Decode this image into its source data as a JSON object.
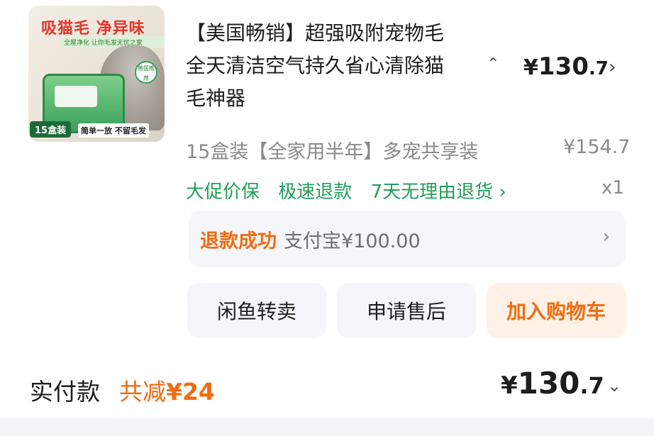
{
  "product": {
    "image": {
      "banner": "吸猫毛 净异味",
      "tagline": "全屋净化 让你毛发无忧之家",
      "badge": "15盒装",
      "slogan": "简单一放 不留毛发",
      "recommend": "兽医推荐"
    },
    "title": "【美国畅销】超强吸附宠物毛全天清洁空气持久省心清除猫毛神器",
    "price_symbol": "¥",
    "price_int": "130",
    "price_dec": ".7",
    "variant": "15盒装【全家用半年】多宠共享装",
    "original_price": "¥154.7",
    "quantity": "x1",
    "services": [
      "大促价保",
      "极速退款",
      "7天无理由退货 ›"
    ]
  },
  "refund": {
    "status": "退款成功",
    "detail": "支付宝¥100.00"
  },
  "actions": {
    "resell": "闲鱼转卖",
    "after_sale": "申请售后",
    "add_to_cart": "加入购物车"
  },
  "summary": {
    "label": "实付款",
    "discount_prefix": "共减",
    "discount_value": "¥24",
    "total_symbol": "¥",
    "total_int": "130",
    "total_dec": ".7"
  },
  "icons": {
    "collapse": "chevron-up-icon",
    "price_detail": "chevron-right-icon",
    "refund_detail": "chevron-right-icon",
    "total_expand": "chevron-down-icon"
  },
  "colors": {
    "accent_orange": "#f26b0f",
    "service_green": "#21a05a",
    "muted_gray": "#8a8a8a"
  }
}
